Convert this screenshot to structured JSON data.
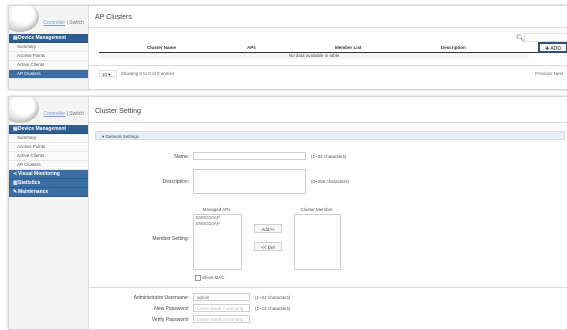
{
  "panel1": {
    "controller_link": "Controller",
    "switch_link": "Switch",
    "sidebar": {
      "section": "Device Management",
      "items": [
        "Summary",
        "Access Points",
        "Active Clients",
        "AP Clusters"
      ]
    },
    "title": "AP Clusters",
    "add_button": "ADD",
    "table": {
      "headers": [
        "Cluster Name",
        "APs",
        "Member List",
        "Description"
      ],
      "empty_text": "No data available in table"
    },
    "page_size": "10",
    "showing": "Showing 0 to 0 of 0 entries",
    "pager": "Previous  Next"
  },
  "panel2": {
    "controller_link": "Controller",
    "switch_link": "Switch",
    "sidebar": {
      "section": "Device Management",
      "items": [
        "Summary",
        "Access Points",
        "Active Clients",
        "AP Clusters"
      ],
      "sections": [
        "Visual Monitoring",
        "Statistics",
        "Maintenance"
      ]
    },
    "title": "Cluster Setting",
    "general_settings": "General Settings",
    "fields": {
      "name_label": "Name:",
      "name_hint": "(1~32 characters)",
      "description_label": "Description:",
      "description_hint": "(0~256 characters)",
      "member_setting_label": "Member Setting:",
      "managed_aps_title": "Managed APs",
      "managed_aps": [
        "EWS310AP",
        "EWS310AP"
      ],
      "cluster_member_title": "Cluster Member",
      "add_button": "Add>>",
      "del_button": "<< Del",
      "show_mac": "Show MAC",
      "admin_user_label": "Administrator Username:",
      "admin_user_value": "admin",
      "admin_user_hint": "(1~32 characters)",
      "new_password_label": "New Password:",
      "new_password_placeholder": "Leave blank if unchang",
      "new_password_hint": "(1~12 characters)",
      "verify_password_label": "Verify Password:",
      "verify_password_placeholder": "Leave blank if unchang"
    }
  }
}
